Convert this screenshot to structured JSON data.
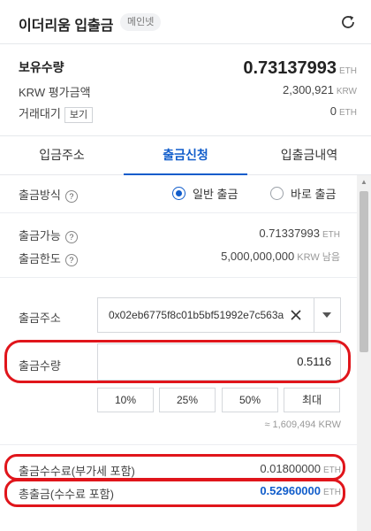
{
  "header": {
    "title": "이더리움 입출금",
    "network_badge": "메인넷"
  },
  "holdings": {
    "balance_label": "보유수량",
    "balance_value": "0.73137993",
    "balance_unit": "ETH",
    "krw_label": "KRW 평가금액",
    "krw_value": "2,300,921",
    "krw_unit": "KRW",
    "pending_label": "거래대기",
    "pending_button": "보기",
    "pending_value": "0",
    "pending_unit": "ETH"
  },
  "tabs": [
    {
      "label": "입금주소",
      "active": false
    },
    {
      "label": "출금신청",
      "active": true
    },
    {
      "label": "입출금내역",
      "active": false
    }
  ],
  "withdraw": {
    "method_label": "출금방식",
    "method_options": [
      {
        "label": "일반 출금",
        "checked": true
      },
      {
        "label": "바로 출금",
        "checked": false
      }
    ],
    "available_label": "출금가능",
    "available_value": "0.71337993",
    "available_unit": "ETH",
    "limit_label": "출금한도",
    "limit_value": "5,000,000,000",
    "limit_unit": "KRW 남음",
    "address_label": "출금주소",
    "address_value": "0x02eb6775f8c01b5bf51992e7c563a",
    "amount_label": "출금수량",
    "amount_value": "0.5116",
    "pct_buttons": [
      "10%",
      "25%",
      "50%",
      "최대"
    ],
    "krw_estimate": "≈ 1,609,494 KRW",
    "fee_label": "출금수수료(부가세 포함)",
    "fee_value": "0.01800000",
    "fee_unit": "ETH",
    "total_label": "총출금(수수료 포함)",
    "total_value": "0.52960000",
    "total_unit": "ETH",
    "help_mark": "?"
  },
  "colors": {
    "accent": "#115dcb",
    "highlight_oval": "#e0151b"
  },
  "icons": {
    "refresh": "refresh-icon",
    "clear": "close-icon",
    "dropdown": "chevron-down-icon",
    "help": "question-mark-icon"
  }
}
